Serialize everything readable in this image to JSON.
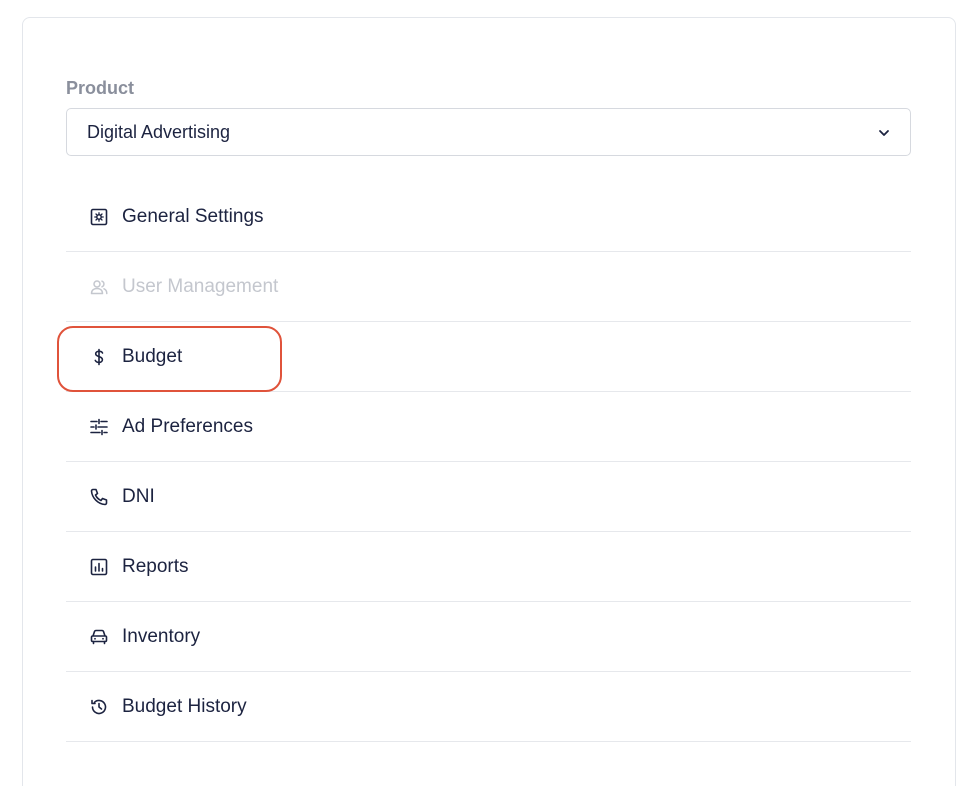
{
  "product": {
    "label": "Product",
    "selected": "Digital Advertising",
    "dropdown_icon": "chevron-down-icon"
  },
  "menu": {
    "items": [
      {
        "label": "General Settings",
        "icon": "gear-square-icon",
        "enabled": true
      },
      {
        "label": "User Management",
        "icon": "users-icon",
        "enabled": false
      },
      {
        "label": "Budget",
        "icon": "dollar-icon",
        "enabled": true,
        "highlighted": true
      },
      {
        "label": "Ad Preferences",
        "icon": "sliders-icon",
        "enabled": true
      },
      {
        "label": "DNI",
        "icon": "phone-icon",
        "enabled": true
      },
      {
        "label": "Reports",
        "icon": "chart-icon",
        "enabled": true
      },
      {
        "label": "Inventory",
        "icon": "car-icon",
        "enabled": true
      },
      {
        "label": "Budget History",
        "icon": "history-icon",
        "enabled": true
      }
    ]
  },
  "colors": {
    "text": "#1c2340",
    "disabled_text": "#c4c7ce",
    "highlight_outline": "#e0533b",
    "label_muted": "#8a8f9c"
  }
}
